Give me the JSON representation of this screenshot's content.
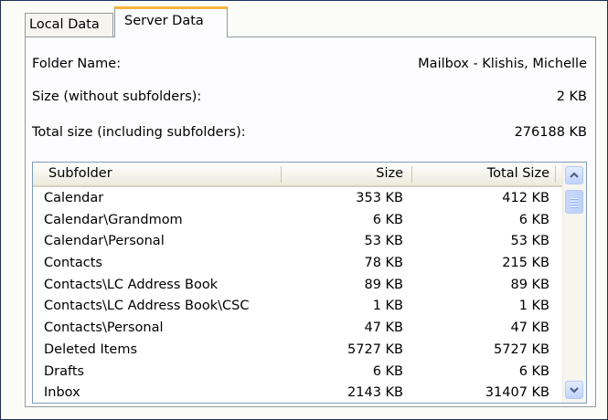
{
  "tabs": [
    {
      "label": "Local Data"
    },
    {
      "label": "Server Data"
    }
  ],
  "info": {
    "folder_name_label": "Folder Name:",
    "folder_name_value": "Mailbox - Klishis, Michelle",
    "size_label": "Size (without subfolders):",
    "size_value": "2 KB",
    "total_label": "Total size (including subfolders):",
    "total_value": "276188 KB"
  },
  "table": {
    "headers": {
      "subfolder": "Subfolder",
      "size": "Size",
      "total": "Total Size"
    },
    "rows": [
      {
        "name": "Calendar",
        "size": "353 KB",
        "total": "412 KB"
      },
      {
        "name": "Calendar\\Grandmom",
        "size": "6 KB",
        "total": "6 KB"
      },
      {
        "name": "Calendar\\Personal",
        "size": "53 KB",
        "total": "53 KB"
      },
      {
        "name": "Contacts",
        "size": "78 KB",
        "total": "215 KB"
      },
      {
        "name": "Contacts\\LC Address Book",
        "size": "89 KB",
        "total": "89 KB"
      },
      {
        "name": "Contacts\\LC Address Book\\CSC",
        "size": "1 KB",
        "total": "1 KB"
      },
      {
        "name": "Contacts\\Personal",
        "size": "47 KB",
        "total": "47 KB"
      },
      {
        "name": "Deleted Items",
        "size": "5727 KB",
        "total": "5727 KB"
      },
      {
        "name": "Drafts",
        "size": "6 KB",
        "total": "6 KB"
      },
      {
        "name": "Inbox",
        "size": "2143 KB",
        "total": "31407 KB"
      }
    ]
  },
  "scrollbar": {
    "up_icon": "chevron-up-icon",
    "down_icon": "chevron-down-icon"
  }
}
